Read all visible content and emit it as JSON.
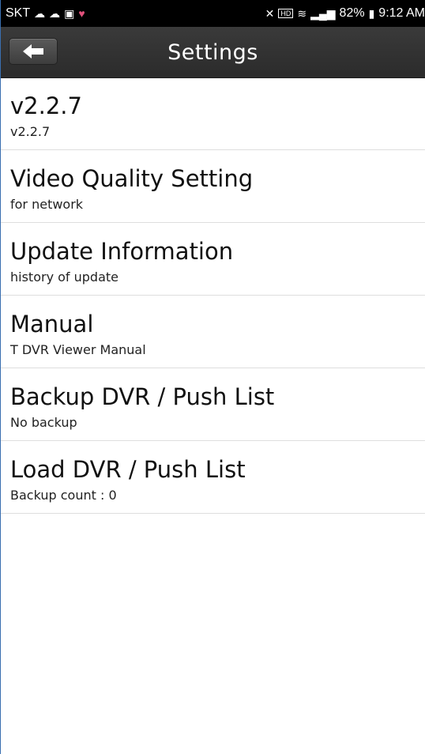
{
  "status_bar": {
    "carrier": "SKT",
    "network_badge": "HD",
    "network_badge_sub": "Voice",
    "battery": "82%",
    "time": "9:12 AM",
    "left_icons": [
      "cloud-icon",
      "cloud-icon",
      "image-icon",
      "heart-check-icon"
    ],
    "right_icons": [
      "mute-icon",
      "hd-voice-icon",
      "wifi-icon",
      "signal-icon",
      "battery-icon"
    ]
  },
  "header": {
    "title": "Settings",
    "back_icon": "arrow-left-icon"
  },
  "settings": {
    "items": [
      {
        "title": "v2.2.7",
        "subtitle": "v2.2.7"
      },
      {
        "title": "Video Quality Setting",
        "subtitle": "for network"
      },
      {
        "title": "Update Information",
        "subtitle": "history of update"
      },
      {
        "title": "Manual",
        "subtitle": "T DVR Viewer Manual"
      },
      {
        "title": "Backup DVR / Push List",
        "subtitle": "No backup"
      },
      {
        "title": "Load DVR / Push List",
        "subtitle": "Backup count : 0"
      }
    ]
  },
  "colors": {
    "status_bar": "#000000",
    "title_bar": "#333333",
    "background": "#ffffff",
    "divider": "#dedede"
  }
}
